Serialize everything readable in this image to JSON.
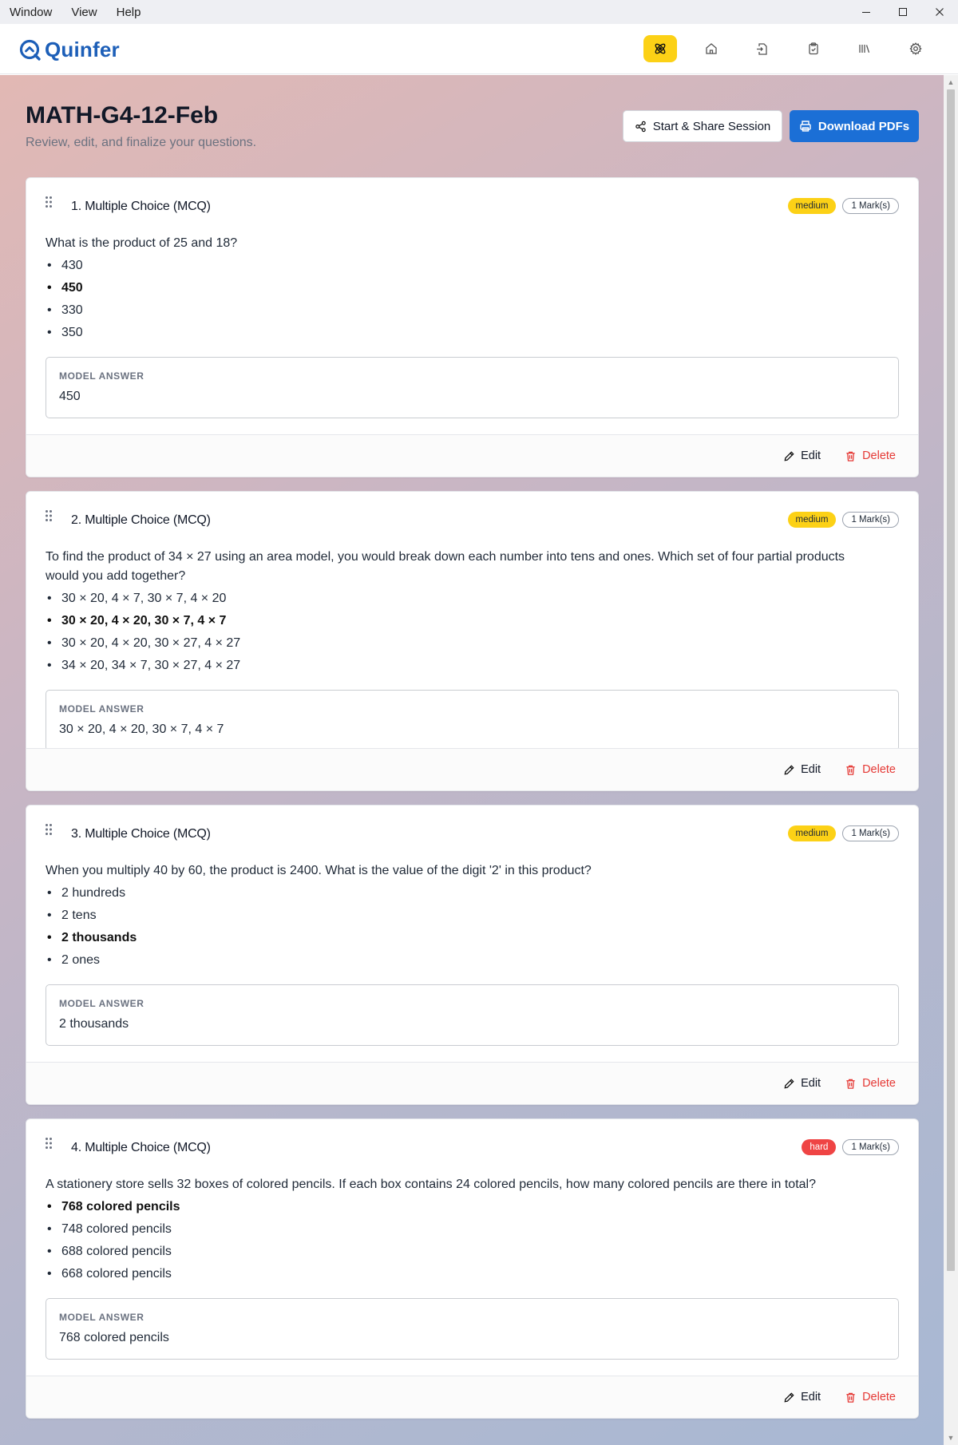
{
  "menubar": {
    "items": [
      "Window",
      "View",
      "Help"
    ]
  },
  "app": {
    "name": "Quinfer"
  },
  "nav": {
    "items": [
      "question-generator",
      "home",
      "import-file",
      "clipboard-check",
      "library",
      "settings"
    ]
  },
  "page": {
    "title": "MATH-G4-12-Feb",
    "subtitle": "Review, edit, and finalize your questions.",
    "share_label": "Start & Share Session",
    "download_label": "Download PDFs"
  },
  "labels": {
    "model_answer": "MODEL ANSWER",
    "edit": "Edit",
    "delete": "Delete"
  },
  "colors": {
    "brand": "#1d5fb8",
    "accent": "#fcd116",
    "primary_button": "#1b6fd6",
    "delete": "#e53935",
    "hard": "#ef4444"
  },
  "questions": [
    {
      "title": "1. Multiple Choice (MCQ)",
      "difficulty": "medium",
      "marks": "1 Mark(s)",
      "text": "What is the product of 25 and 18?",
      "options": [
        "430",
        "450",
        "330",
        "350"
      ],
      "correct_index": 1,
      "model_answer": "450"
    },
    {
      "title": "2. Multiple Choice (MCQ)",
      "difficulty": "medium",
      "marks": "1 Mark(s)",
      "text": "To find the product of 34 × 27 using an area model, you would break down each number into tens and ones. Which set of four partial products would you add together?",
      "options": [
        "30 × 20, 4 × 7, 30 × 7, 4 × 20",
        "30 × 20, 4 × 20, 30 × 7, 4 × 7",
        "30 × 20, 4 × 20, 30 × 27, 4 × 27",
        "34 × 20, 34 × 7, 30 × 27, 4 × 27"
      ],
      "correct_index": 1,
      "model_answer": "30 × 20, 4 × 20, 30 × 7, 4 × 7"
    },
    {
      "title": "3. Multiple Choice (MCQ)",
      "difficulty": "medium",
      "marks": "1 Mark(s)",
      "text": "When you multiply 40 by 60, the product is 2400. What is the value of the digit '2' in this product?",
      "options": [
        "2 hundreds",
        "2 tens",
        "2 thousands",
        "2 ones"
      ],
      "correct_index": 2,
      "model_answer": "2 thousands"
    },
    {
      "title": "4. Multiple Choice (MCQ)",
      "difficulty": "hard",
      "marks": "1 Mark(s)",
      "text": "A stationery store sells 32 boxes of colored pencils. If each box contains 24 colored pencils, how many colored pencils are there in total?",
      "options": [
        "768 colored pencils",
        "748 colored pencils",
        "688 colored pencils",
        "668 colored pencils"
      ],
      "correct_index": 0,
      "model_answer": "768 colored pencils"
    }
  ]
}
